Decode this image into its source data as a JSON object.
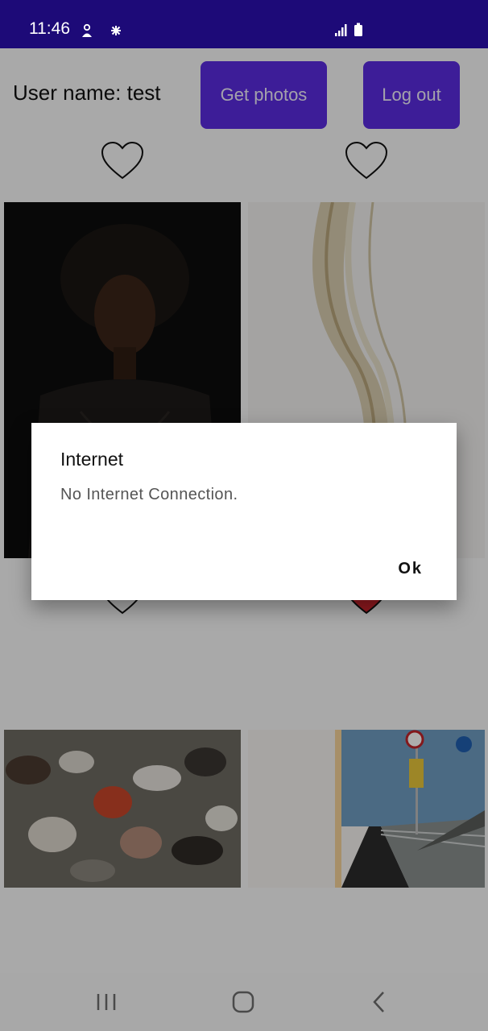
{
  "status_bar": {
    "time": "11:46"
  },
  "header": {
    "username_label": "User name: test",
    "get_photos_label": "Get photos",
    "logout_label": "Log out"
  },
  "colors": {
    "accent": "#5b2ce0",
    "status_bar": "#1d0a78",
    "liked_heart": "#d8262f"
  },
  "photos": [
    {
      "name": "portrait-woman",
      "liked": false
    },
    {
      "name": "abstract-paper-waves",
      "liked": true
    },
    {
      "name": "blurred-crowd",
      "liked": false
    },
    {
      "name": "bridge-road-signs",
      "liked": false
    }
  ],
  "dialog": {
    "title": "Internet",
    "message": "No Internet Connection.",
    "ok_label": "Ok"
  },
  "nav_bar": {
    "icons": [
      "recent-apps-icon",
      "home-icon",
      "back-icon"
    ]
  }
}
